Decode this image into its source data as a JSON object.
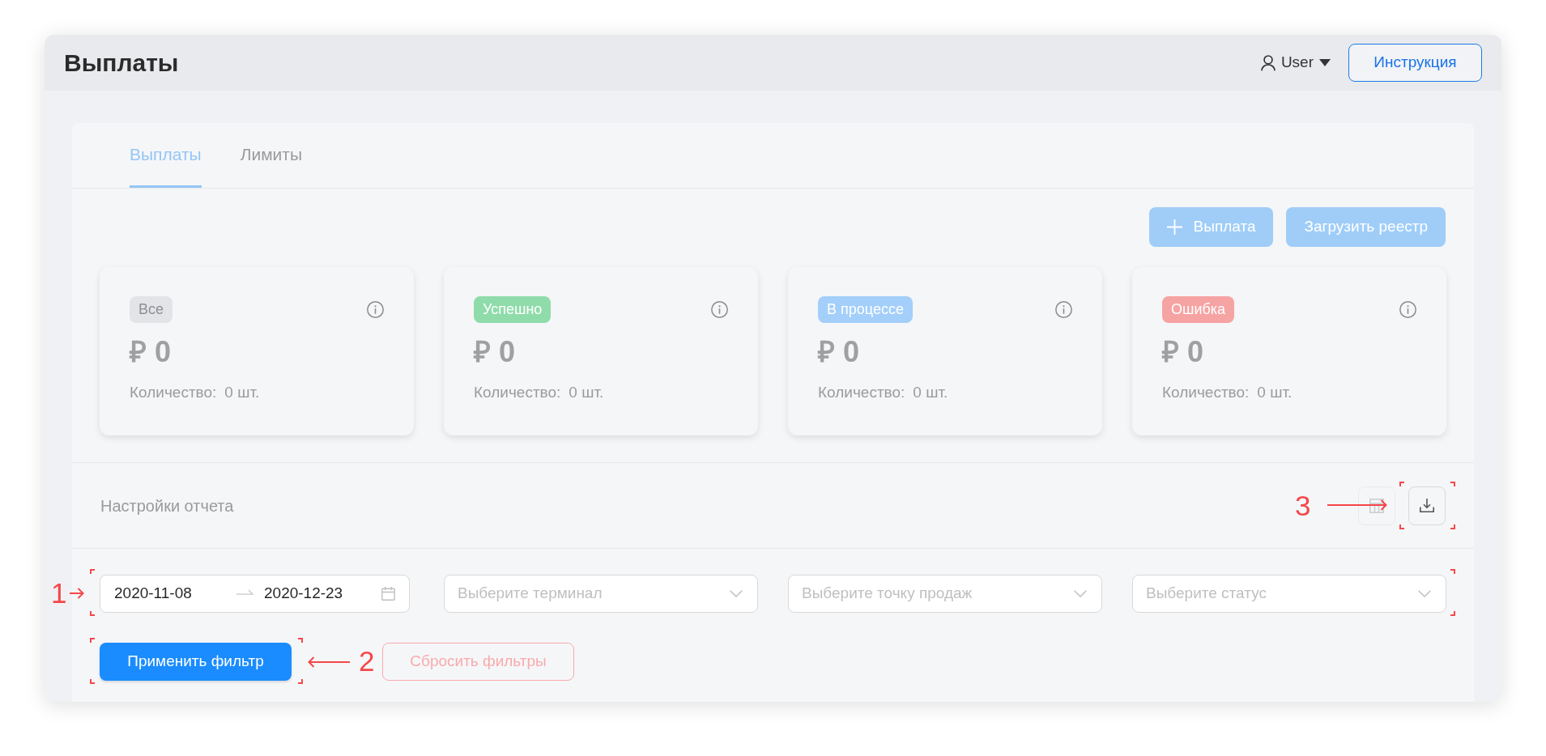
{
  "window": {
    "title": "Выплаты"
  },
  "header": {
    "user_menu": {
      "label": "User"
    },
    "help_button": {
      "label": "Инструкция"
    }
  },
  "tabs": [
    {
      "label": "Выплаты",
      "selected": true
    },
    {
      "label": "Лимиты",
      "selected": false
    }
  ],
  "actions": [
    {
      "label": "Выплата",
      "kind": "add",
      "disabled": true
    },
    {
      "label": "Загрузить реестр",
      "kind": "upload",
      "disabled": true
    }
  ],
  "summary_cards": [
    {
      "status": "Все",
      "color": "#e3e4e7",
      "amount": "₽ 0",
      "count_label": "Количество:",
      "count": "0 шт."
    },
    {
      "status": "Успешно",
      "color": "#8fdcaa",
      "amount": "₽ 0",
      "count_label": "Количество:",
      "count": "0 шт."
    },
    {
      "status": "В процессе",
      "color": "#a3cffa",
      "amount": "₽ 0",
      "count_label": "Количество:",
      "count": "0 шт."
    },
    {
      "status": "Ошибка",
      "color": "#f6a3a3",
      "amount": "₽ 0",
      "count_label": "Количество:",
      "count": "0 шт."
    }
  ],
  "report_settings": {
    "title": "Настройки отчета",
    "tools": [
      {
        "kind": "table",
        "disabled": true
      },
      {
        "kind": "download",
        "disabled": false,
        "annotation": "3"
      }
    ]
  },
  "filters": {
    "annotation": "1",
    "date_range": {
      "start": "2020-11-08",
      "end": "2020-12-23"
    },
    "selects": [
      {
        "placeholder": "Выберите терминал"
      },
      {
        "placeholder": "Выберите точку продаж"
      },
      {
        "placeholder": "Выберите статус"
      }
    ]
  },
  "filter_buttons": [
    {
      "label": "Применить фильтр",
      "kind": "primary",
      "disabled": false,
      "annotation": "2"
    },
    {
      "label": "Сбросить фильтры",
      "kind": "danger",
      "disabled": true
    }
  ]
}
